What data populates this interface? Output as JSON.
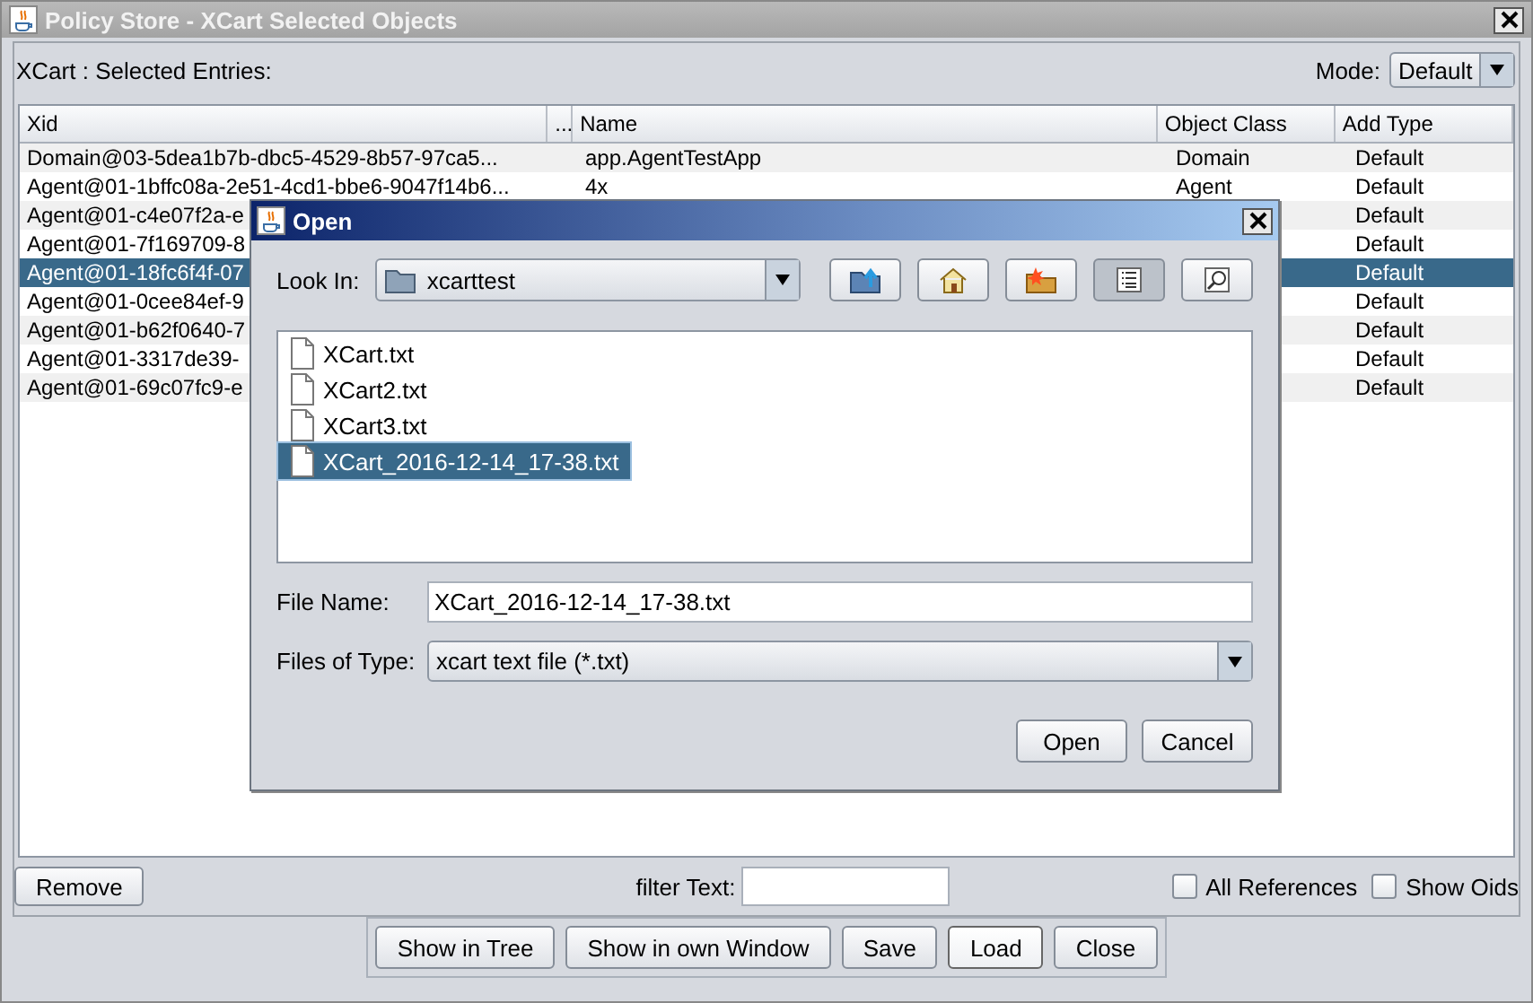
{
  "window": {
    "title": "Policy Store - XCart Selected Objects"
  },
  "heading": "XCart : Selected Entries:",
  "mode": {
    "label": "Mode:",
    "value": "Default"
  },
  "table": {
    "columns": [
      "Xid",
      "...",
      "Name",
      "Object Class",
      "Add Type"
    ],
    "rows": [
      {
        "cells": [
          "Domain@03-5dea1b7b-dbc5-4529-8b57-97ca5...",
          "",
          "app.AgentTestApp",
          "Domain",
          "Default"
        ],
        "selected": false
      },
      {
        "cells": [
          "Agent@01-1bffc08a-2e51-4cd1-bbe6-9047f14b6...",
          "",
          "4x",
          "Agent",
          "Default"
        ],
        "selected": false
      },
      {
        "cells": [
          "Agent@01-c4e07f2a-e",
          "",
          "",
          "",
          "Default"
        ],
        "selected": false
      },
      {
        "cells": [
          "Agent@01-7f169709-8",
          "",
          "",
          "",
          "Default"
        ],
        "selected": false
      },
      {
        "cells": [
          "Agent@01-18fc6f4f-07",
          "",
          "",
          "",
          "Default"
        ],
        "selected": true
      },
      {
        "cells": [
          "Agent@01-0cee84ef-9",
          "",
          "",
          "",
          "Default"
        ],
        "selected": false
      },
      {
        "cells": [
          "Agent@01-b62f0640-7",
          "",
          "",
          "",
          "Default"
        ],
        "selected": false
      },
      {
        "cells": [
          "Agent@01-3317de39-",
          "",
          "",
          "",
          "Default"
        ],
        "selected": false
      },
      {
        "cells": [
          "Agent@01-69c07fc9-e",
          "",
          "",
          "",
          "Default"
        ],
        "selected": false
      }
    ]
  },
  "remove_button": "Remove",
  "filter": {
    "label": "filter Text:"
  },
  "checkboxes": [
    {
      "label": "All References",
      "checked": false
    },
    {
      "label": "Show Oids",
      "checked": false
    }
  ],
  "buttons": [
    {
      "label": "Show in Tree",
      "focused": false
    },
    {
      "label": "Show in own Window",
      "focused": false
    },
    {
      "label": "Save",
      "focused": false
    },
    {
      "label": "Load",
      "focused": true
    },
    {
      "label": "Close",
      "focused": false
    }
  ],
  "dialog": {
    "title": "Open",
    "look_in": {
      "label": "Look In:",
      "value": "xcarttest"
    },
    "view_buttons": [
      {
        "kind": "up",
        "selected": false
      },
      {
        "kind": "home",
        "selected": false
      },
      {
        "kind": "newfolder",
        "selected": false
      },
      {
        "kind": "list",
        "selected": true
      },
      {
        "kind": "details",
        "selected": false
      }
    ],
    "files": [
      {
        "name": "XCart.txt",
        "selected": false
      },
      {
        "name": "XCart2.txt",
        "selected": false
      },
      {
        "name": "XCart3.txt",
        "selected": false
      },
      {
        "name": "XCart_2016-12-14_17-38.txt",
        "selected": true
      }
    ],
    "file_name": {
      "label": "File Name:",
      "value": "XCart_2016-12-14_17-38.txt"
    },
    "file_type": {
      "label": "Files of Type:",
      "value": "xcart text file (*.txt)"
    },
    "buttons": [
      "Open",
      "Cancel"
    ]
  }
}
